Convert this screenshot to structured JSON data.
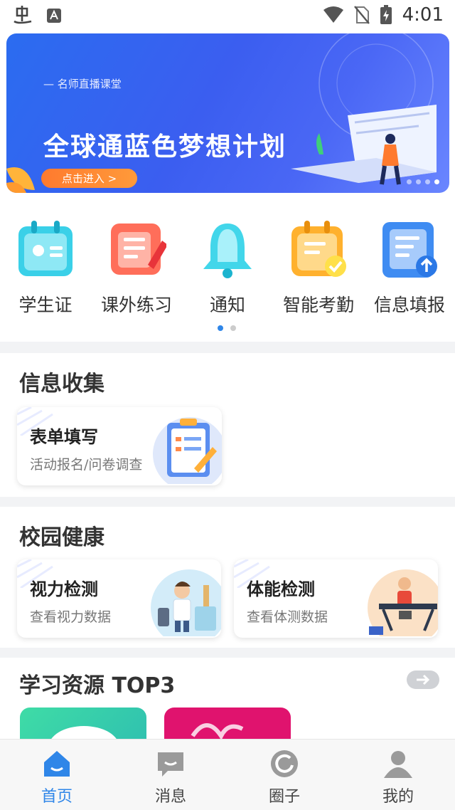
{
  "status_bar": {
    "time": "4:01"
  },
  "banner": {
    "subtitle": "— 名师直播课堂",
    "title": "全球通蓝色梦想计划",
    "button_label": "点击进入 >"
  },
  "quick_menu": [
    {
      "label": "学生证",
      "icon": "student-id-icon"
    },
    {
      "label": "课外练习",
      "icon": "exercise-icon"
    },
    {
      "label": "通知",
      "icon": "bell-icon"
    },
    {
      "label": "智能考勤",
      "icon": "attendance-icon"
    },
    {
      "label": "信息填报",
      "icon": "info-upload-icon"
    }
  ],
  "info_collect": {
    "title": "信息收集",
    "cards": [
      {
        "title": "表单填写",
        "subtitle": "活动报名/问卷调查"
      }
    ]
  },
  "campus_health": {
    "title": "校园健康",
    "cards": [
      {
        "title": "视力检测",
        "subtitle": "查看视力数据"
      },
      {
        "title": "体能检测",
        "subtitle": "查看体测数据"
      }
    ]
  },
  "resources": {
    "title": "学习资源 TOP3"
  },
  "tab_bar": [
    {
      "label": "首页",
      "icon": "home-icon",
      "active": true
    },
    {
      "label": "消息",
      "icon": "message-icon",
      "active": false
    },
    {
      "label": "圈子",
      "icon": "circle-icon",
      "active": false
    },
    {
      "label": "我的",
      "icon": "profile-icon",
      "active": false
    }
  ],
  "colors": {
    "accent": "#2f86e8",
    "banner_bg": "#3b5ef0",
    "tab_inactive": "#9a9a9a"
  }
}
